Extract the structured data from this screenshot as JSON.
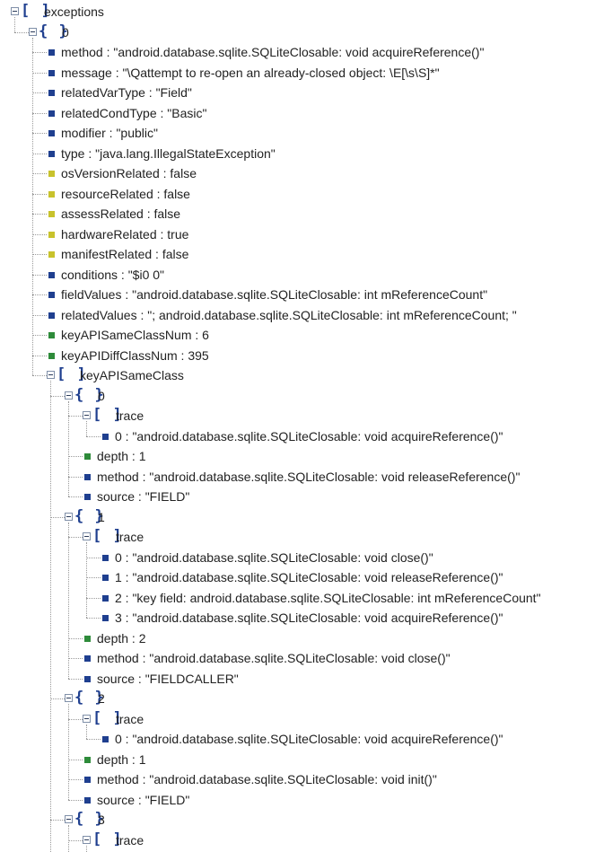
{
  "colors": {
    "string": "#1f3f8f",
    "boolean": "#c8c22c",
    "number": "#2e8b3a"
  },
  "nodes": [
    {
      "depth": 0,
      "kind": "array",
      "label": "exceptions"
    },
    {
      "depth": 1,
      "kind": "object",
      "label": "0"
    },
    {
      "depth": 2,
      "kind": "string",
      "label": "method : \"android.database.sqlite.SQLiteClosable: void acquireReference()\""
    },
    {
      "depth": 2,
      "kind": "string",
      "label": "message : \"\\Qattempt to re-open an already-closed object: \\E[\\s\\S]*\""
    },
    {
      "depth": 2,
      "kind": "string",
      "label": "relatedVarType : \"Field\""
    },
    {
      "depth": 2,
      "kind": "string",
      "label": "relatedCondType : \"Basic\""
    },
    {
      "depth": 2,
      "kind": "string",
      "label": "modifier : \"public\""
    },
    {
      "depth": 2,
      "kind": "string",
      "label": "type : \"java.lang.IllegalStateException\""
    },
    {
      "depth": 2,
      "kind": "boolean",
      "label": "osVersionRelated : false"
    },
    {
      "depth": 2,
      "kind": "boolean",
      "label": "resourceRelated : false"
    },
    {
      "depth": 2,
      "kind": "boolean",
      "label": "assessRelated : false"
    },
    {
      "depth": 2,
      "kind": "boolean",
      "label": "hardwareRelated : true"
    },
    {
      "depth": 2,
      "kind": "boolean",
      "label": "manifestRelated : false"
    },
    {
      "depth": 2,
      "kind": "string",
      "label": "conditions : \"$i0 0\""
    },
    {
      "depth": 2,
      "kind": "string",
      "label": "fieldValues : \"android.database.sqlite.SQLiteClosable: int mReferenceCount\""
    },
    {
      "depth": 2,
      "kind": "string",
      "label": "relatedValues : \"; android.database.sqlite.SQLiteClosable: int mReferenceCount; \""
    },
    {
      "depth": 2,
      "kind": "number",
      "label": "keyAPISameClassNum : 6"
    },
    {
      "depth": 2,
      "kind": "number",
      "label": "keyAPIDiffClassNum : 395"
    },
    {
      "depth": 2,
      "kind": "array",
      "label": "keyAPISameClass"
    },
    {
      "depth": 3,
      "kind": "object",
      "label": "0"
    },
    {
      "depth": 4,
      "kind": "array",
      "label": "trace"
    },
    {
      "depth": 5,
      "kind": "string",
      "label": "0 : \"android.database.sqlite.SQLiteClosable: void acquireReference()\""
    },
    {
      "depth": 4,
      "kind": "number",
      "label": "depth : 1"
    },
    {
      "depth": 4,
      "kind": "string",
      "label": "method : \"android.database.sqlite.SQLiteClosable: void releaseReference()\""
    },
    {
      "depth": 4,
      "kind": "string",
      "label": "source : \"FIELD\""
    },
    {
      "depth": 3,
      "kind": "object",
      "label": "1"
    },
    {
      "depth": 4,
      "kind": "array",
      "label": "trace"
    },
    {
      "depth": 5,
      "kind": "string",
      "label": "0 : \"android.database.sqlite.SQLiteClosable: void close()\""
    },
    {
      "depth": 5,
      "kind": "string",
      "label": "1 : \"android.database.sqlite.SQLiteClosable: void releaseReference()\""
    },
    {
      "depth": 5,
      "kind": "string",
      "label": "2 : \"key field: android.database.sqlite.SQLiteClosable: int mReferenceCount\""
    },
    {
      "depth": 5,
      "kind": "string",
      "label": "3 : \"android.database.sqlite.SQLiteClosable: void acquireReference()\""
    },
    {
      "depth": 4,
      "kind": "number",
      "label": "depth : 2"
    },
    {
      "depth": 4,
      "kind": "string",
      "label": "method : \"android.database.sqlite.SQLiteClosable: void close()\""
    },
    {
      "depth": 4,
      "kind": "string",
      "label": "source : \"FIELDCALLER\""
    },
    {
      "depth": 3,
      "kind": "object",
      "label": "2"
    },
    {
      "depth": 4,
      "kind": "array",
      "label": "trace"
    },
    {
      "depth": 5,
      "kind": "string",
      "label": "0 : \"android.database.sqlite.SQLiteClosable: void acquireReference()\""
    },
    {
      "depth": 4,
      "kind": "number",
      "label": "depth : 1"
    },
    {
      "depth": 4,
      "kind": "string",
      "label": "method : \"android.database.sqlite.SQLiteClosable: void init()\""
    },
    {
      "depth": 4,
      "kind": "string",
      "label": "source : \"FIELD\""
    },
    {
      "depth": 3,
      "kind": "object",
      "label": "3"
    },
    {
      "depth": 4,
      "kind": "array",
      "label": "trace"
    }
  ]
}
